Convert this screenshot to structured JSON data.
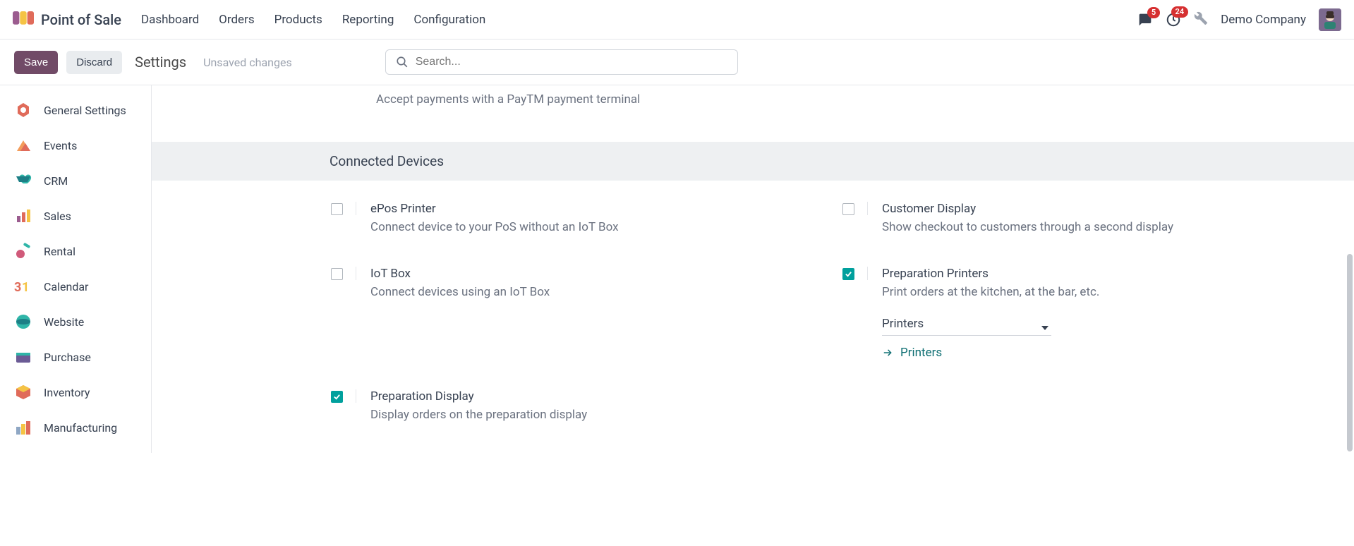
{
  "app": {
    "name": "Point of Sale"
  },
  "nav": {
    "items": [
      {
        "label": "Dashboard"
      },
      {
        "label": "Orders"
      },
      {
        "label": "Products"
      },
      {
        "label": "Reporting"
      },
      {
        "label": "Configuration"
      }
    ]
  },
  "topbar": {
    "messages_count": "5",
    "activities_count": "24",
    "company": "Demo Company"
  },
  "actionbar": {
    "save": "Save",
    "discard": "Discard",
    "title": "Settings",
    "status": "Unsaved changes",
    "search_placeholder": "Search..."
  },
  "sidebar": {
    "items": [
      {
        "label": "General Settings"
      },
      {
        "label": "Events"
      },
      {
        "label": "CRM"
      },
      {
        "label": "Sales"
      },
      {
        "label": "Rental"
      },
      {
        "label": "Calendar"
      },
      {
        "label": "Website"
      },
      {
        "label": "Purchase"
      },
      {
        "label": "Inventory"
      },
      {
        "label": "Manufacturing"
      }
    ]
  },
  "prev_section": {
    "desc": "Accept payments with a PayTM payment terminal"
  },
  "section": {
    "title": "Connected Devices"
  },
  "settings": {
    "epos": {
      "title": "ePos Printer",
      "desc": "Connect device to your PoS without an IoT Box",
      "checked": false
    },
    "customer_display": {
      "title": "Customer Display",
      "desc": "Show checkout to customers through a second display",
      "checked": false
    },
    "iot": {
      "title": "IoT Box",
      "desc": "Connect devices using an IoT Box",
      "checked": false
    },
    "prep_printers": {
      "title": "Preparation Printers",
      "desc": "Print orders at the kitchen, at the bar, etc.",
      "checked": true,
      "field_label": "Printers",
      "link_label": "Printers"
    },
    "prep_display": {
      "title": "Preparation Display",
      "desc": "Display orders on the preparation display",
      "checked": true
    }
  }
}
